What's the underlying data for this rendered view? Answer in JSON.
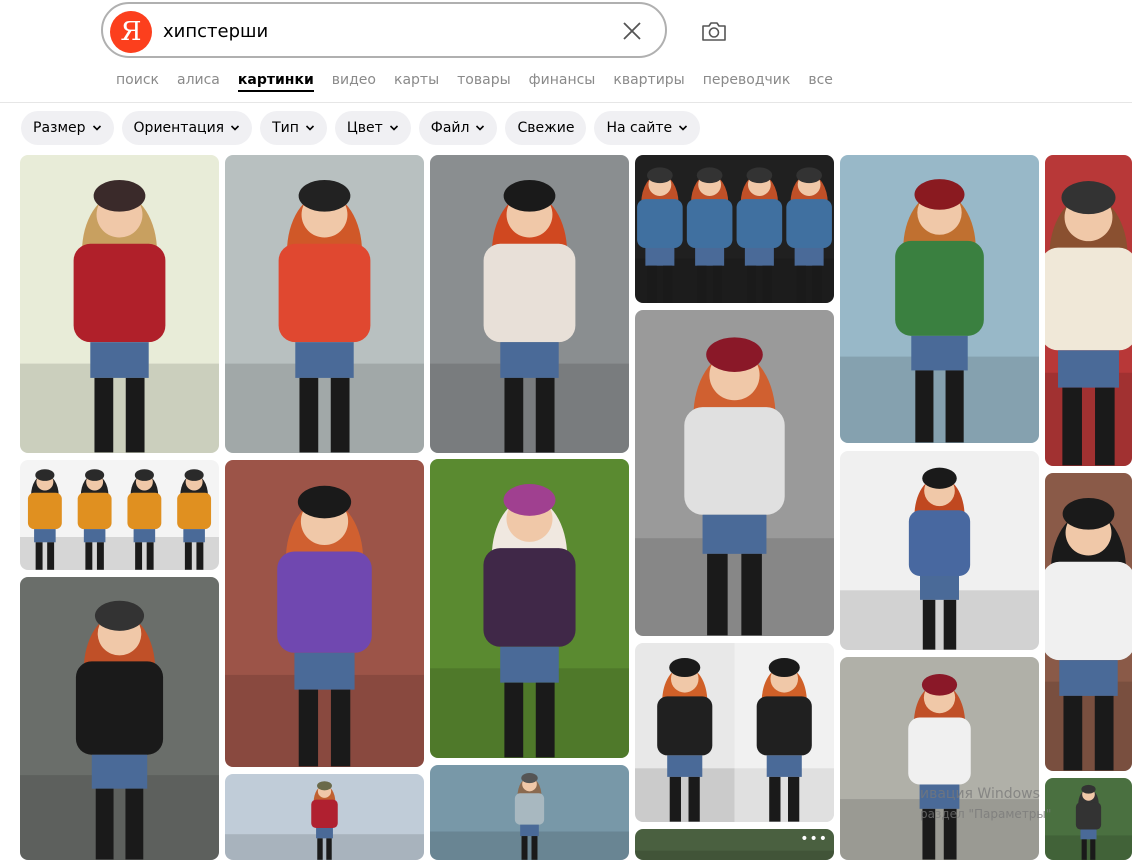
{
  "search": {
    "logo_letter": "Я",
    "query": "хипстерши"
  },
  "tabs": [
    {
      "label": "поиск",
      "active": false
    },
    {
      "label": "алиса",
      "active": false
    },
    {
      "label": "картинки",
      "active": true
    },
    {
      "label": "видео",
      "active": false
    },
    {
      "label": "карты",
      "active": false
    },
    {
      "label": "товары",
      "active": false
    },
    {
      "label": "финансы",
      "active": false
    },
    {
      "label": "квартиры",
      "active": false
    },
    {
      "label": "переводчик",
      "active": false
    },
    {
      "label": "все",
      "active": false
    }
  ],
  "filters": [
    {
      "label": "Размер",
      "dropdown": true
    },
    {
      "label": "Ориентация",
      "dropdown": true
    },
    {
      "label": "Тип",
      "dropdown": true
    },
    {
      "label": "Цвет",
      "dropdown": true
    },
    {
      "label": "Файл",
      "dropdown": true
    },
    {
      "label": "Свежие",
      "dropdown": false
    },
    {
      "label": "На сайте",
      "dropdown": true
    }
  ],
  "results": {
    "more_glyph": "•••"
  },
  "watermark": {
    "line1": "ивация Windows",
    "line2": "раздел \"Параметры\""
  },
  "colors": {
    "brand": "#fc3f1d",
    "chip_bg": "#f0f0f3",
    "tab_inactive": "#8a8a8a"
  }
}
